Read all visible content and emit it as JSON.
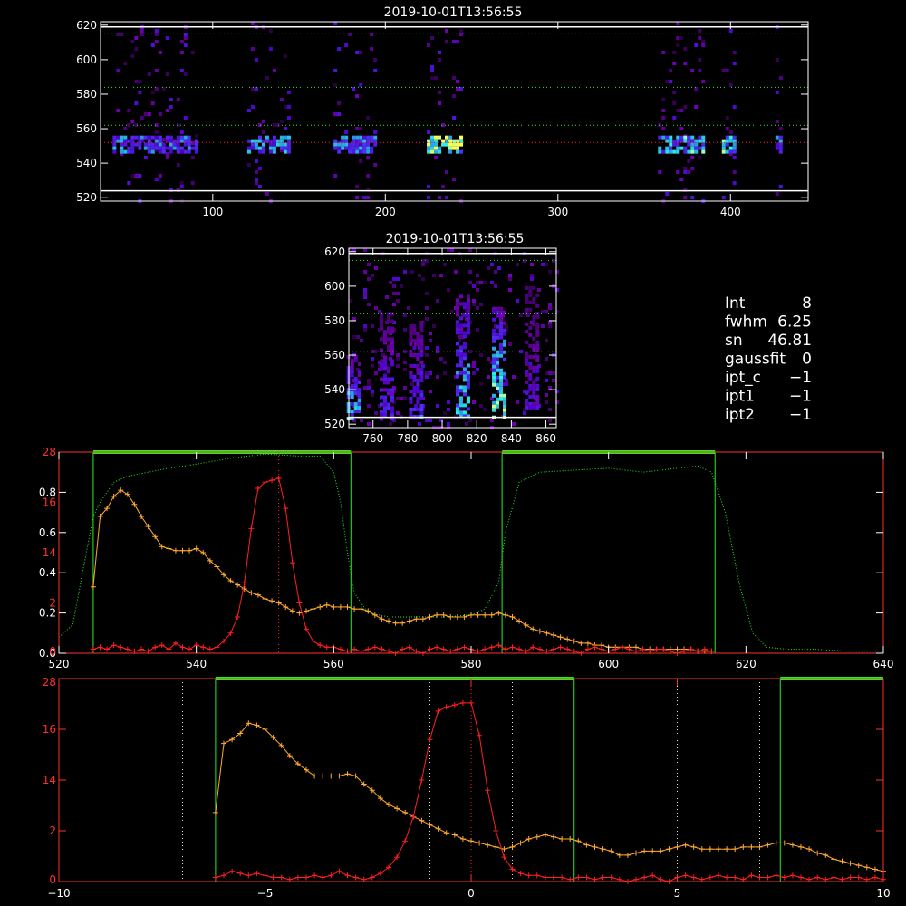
{
  "colors": {
    "background": "#000000",
    "axis": "#ffffff",
    "axis_red": "#ff3030",
    "green": "#22ee22",
    "red": "#ff2020",
    "orange": "#ffaa33",
    "dotted_green": "#22ee22",
    "dotted_white": "#dddddd",
    "dotted_red": "#ff3030"
  },
  "info_panel": {
    "lines": [
      {
        "label": "Int",
        "value": "8"
      },
      {
        "label": "fwhm",
        "value": "6.25"
      },
      {
        "label": "sn",
        "value": "46.81"
      },
      {
        "label": "gaussfit",
        "value": "0"
      },
      {
        "label": "ipt_c",
        "value": "−1"
      },
      {
        "label": "ipt1",
        "value": "−1"
      },
      {
        "label": "ipt2",
        "value": "−1"
      }
    ]
  },
  "chart_data": [
    {
      "id": "top_image",
      "type": "heatmap",
      "title": "2019-10-01T13:56:55",
      "xlim": [
        35,
        445
      ],
      "ylim": [
        518,
        622
      ],
      "xticks": [
        100,
        200,
        300,
        400
      ],
      "yticks": [
        520,
        540,
        560,
        580,
        600,
        620
      ],
      "hlines_white": [
        524,
        619
      ],
      "hlines_green": [
        562,
        584,
        615
      ],
      "hline_red": 552,
      "blocks": [
        {
          "x0": 42,
          "x1": 58,
          "intensity": 0.55
        },
        {
          "x0": 58,
          "x1": 90,
          "intensity": 0.5
        },
        {
          "x0": 120,
          "x1": 145,
          "intensity": 0.6
        },
        {
          "x0": 170,
          "x1": 195,
          "intensity": 0.55
        },
        {
          "x0": 224,
          "x1": 244,
          "intensity": 0.95
        },
        {
          "x0": 358,
          "x1": 385,
          "intensity": 0.7
        },
        {
          "x0": 395,
          "x1": 403,
          "intensity": 0.8
        },
        {
          "x0": 426,
          "x1": 429,
          "intensity": 0.6
        }
      ],
      "band_y": [
        546,
        556
      ]
    },
    {
      "id": "middle_image",
      "type": "heatmap",
      "title": "2019-10-01T13:56:55",
      "xlim": [
        746,
        866
      ],
      "ylim": [
        518,
        622
      ],
      "xticks": [
        760,
        780,
        800,
        820,
        840,
        860
      ],
      "yticks": [
        520,
        540,
        560,
        580,
        600,
        620
      ],
      "hlines_white": [
        524,
        619
      ],
      "hlines_green": [
        562,
        584,
        615
      ],
      "streaks": [
        {
          "x": 749,
          "y0": 524,
          "y1": 560,
          "intensity": 0.7
        },
        {
          "x": 768,
          "y0": 524,
          "y1": 585,
          "intensity": 0.45
        },
        {
          "x": 785,
          "y0": 524,
          "y1": 580,
          "intensity": 0.5
        },
        {
          "x": 812,
          "y0": 524,
          "y1": 595,
          "intensity": 0.75
        },
        {
          "x": 833,
          "y0": 524,
          "y1": 588,
          "intensity": 0.95
        },
        {
          "x": 852,
          "y0": 530,
          "y1": 600,
          "intensity": 0.35
        }
      ]
    },
    {
      "id": "spectrum_wavelength",
      "type": "line",
      "xlim": [
        520,
        640
      ],
      "ylim_left": [
        0.0,
        1.0
      ],
      "yticks_left": [
        0.0,
        0.2,
        0.4,
        0.6,
        0.8
      ],
      "xticks": [
        520,
        540,
        560,
        580,
        600,
        620,
        640
      ],
      "right_axis_labels": [
        {
          "text": "0",
          "y": 0.0
        },
        {
          "text": "2",
          "y": 0.25
        },
        {
          "text": "14",
          "y": 0.5
        },
        {
          "text": "16",
          "y": 0.75
        },
        {
          "text": "28",
          "y": 1.0
        }
      ],
      "green_windows": [
        [
          525,
          562.5
        ],
        [
          584.5,
          615.5
        ]
      ],
      "red_vline": 552,
      "filter_curve": {
        "name": "",
        "x": [
          520,
          522,
          524,
          525,
          526,
          528,
          530,
          533,
          536,
          540,
          545,
          550,
          555,
          558,
          560,
          561,
          562,
          563,
          565,
          568,
          572,
          576,
          580,
          582,
          584,
          585,
          587,
          590,
          595,
          600,
          605,
          610,
          613,
          615,
          617,
          619,
          621,
          623,
          626,
          630,
          635,
          640
        ],
        "y": [
          0.08,
          0.14,
          0.5,
          0.68,
          0.75,
          0.85,
          0.88,
          0.9,
          0.92,
          0.94,
          0.97,
          0.99,
          0.98,
          0.98,
          0.9,
          0.75,
          0.5,
          0.3,
          0.2,
          0.18,
          0.18,
          0.18,
          0.19,
          0.22,
          0.35,
          0.6,
          0.85,
          0.9,
          0.91,
          0.92,
          0.9,
          0.92,
          0.93,
          0.9,
          0.7,
          0.35,
          0.1,
          0.03,
          0.02,
          0.02,
          0.01,
          0.01
        ]
      },
      "red_series": {
        "name": "",
        "x": [
          525,
          526,
          527,
          528,
          529,
          530,
          531,
          532,
          533,
          534,
          535,
          536,
          537,
          538,
          539,
          540,
          541,
          542,
          543,
          544,
          545,
          546,
          547,
          548,
          549,
          550,
          551,
          552,
          553,
          554,
          555,
          556,
          557,
          558,
          559,
          560,
          561,
          562,
          563,
          564,
          565,
          566,
          567,
          568,
          569,
          570,
          571,
          572,
          573,
          574,
          575,
          576,
          577,
          578,
          579,
          580,
          581,
          582,
          583,
          584,
          585,
          586,
          587,
          588,
          589,
          590,
          591,
          592,
          593,
          594,
          595,
          596,
          597,
          598,
          599,
          600,
          601,
          602,
          603,
          604,
          605,
          606,
          607,
          608,
          609,
          610,
          611,
          612,
          613,
          614,
          615
        ],
        "y": [
          0.02,
          0.03,
          0.02,
          0.04,
          0.03,
          0.02,
          0.01,
          0.02,
          0.01,
          0.03,
          0.04,
          0.02,
          0.05,
          0.03,
          0.02,
          0.04,
          0.03,
          0.02,
          0.03,
          0.06,
          0.1,
          0.18,
          0.35,
          0.62,
          0.82,
          0.85,
          0.86,
          0.87,
          0.72,
          0.45,
          0.25,
          0.12,
          0.06,
          0.04,
          0.03,
          0.03,
          0.02,
          0.01,
          0.02,
          0.01,
          0.02,
          0.03,
          0.02,
          0.01,
          0.0,
          0.02,
          0.03,
          0.01,
          0.0,
          0.02,
          0.03,
          0.02,
          0.01,
          0.02,
          0.03,
          0.02,
          0.01,
          0.02,
          0.03,
          0.04,
          0.02,
          0.03,
          0.02,
          0.01,
          0.03,
          0.02,
          0.01,
          0.02,
          0.03,
          0.02,
          0.01,
          0.0,
          0.02,
          0.03,
          0.02,
          0.01,
          0.02,
          0.03,
          0.02,
          0.01,
          0.02,
          0.01,
          0.02,
          0.02,
          0.01,
          0.0,
          0.01,
          0.02,
          0.01,
          0.02,
          0.01
        ]
      },
      "orange_series": {
        "name": "",
        "x": [
          525,
          526,
          527,
          528,
          529,
          530,
          531,
          532,
          533,
          534,
          535,
          536,
          537,
          538,
          539,
          540,
          541,
          542,
          543,
          544,
          545,
          546,
          547,
          548,
          549,
          550,
          551,
          552,
          553,
          554,
          555,
          556,
          557,
          558,
          559,
          560,
          561,
          562,
          563,
          564,
          565,
          566,
          567,
          568,
          569,
          570,
          571,
          572,
          573,
          574,
          575,
          576,
          577,
          578,
          579,
          580,
          581,
          582,
          583,
          584,
          585,
          586,
          587,
          588,
          589,
          590,
          591,
          592,
          593,
          594,
          595,
          596,
          597,
          598,
          599,
          600,
          601,
          602,
          603,
          604,
          605,
          606,
          607,
          608,
          609,
          610,
          611,
          612,
          613,
          614,
          615
        ],
        "y": [
          0.33,
          0.68,
          0.72,
          0.78,
          0.81,
          0.79,
          0.74,
          0.68,
          0.63,
          0.58,
          0.53,
          0.52,
          0.51,
          0.51,
          0.51,
          0.52,
          0.5,
          0.46,
          0.43,
          0.39,
          0.36,
          0.34,
          0.32,
          0.3,
          0.29,
          0.27,
          0.26,
          0.25,
          0.23,
          0.21,
          0.2,
          0.21,
          0.22,
          0.23,
          0.24,
          0.23,
          0.23,
          0.23,
          0.22,
          0.22,
          0.21,
          0.19,
          0.17,
          0.16,
          0.15,
          0.15,
          0.16,
          0.17,
          0.17,
          0.18,
          0.19,
          0.19,
          0.18,
          0.18,
          0.18,
          0.19,
          0.19,
          0.19,
          0.19,
          0.2,
          0.19,
          0.18,
          0.16,
          0.14,
          0.12,
          0.11,
          0.1,
          0.09,
          0.08,
          0.07,
          0.06,
          0.05,
          0.05,
          0.04,
          0.04,
          0.03,
          0.03,
          0.03,
          0.03,
          0.03,
          0.02,
          0.02,
          0.02,
          0.02,
          0.02,
          0.02,
          0.02,
          0.02,
          0.01,
          0.01,
          0.01
        ]
      }
    },
    {
      "id": "spectrum_velocity",
      "type": "line",
      "xlim": [
        -10,
        10
      ],
      "ylim": [
        0,
        1.0
      ],
      "xticks": [
        -10,
        -5,
        0,
        5,
        10
      ],
      "left_axis_labels": [
        {
          "text": "0",
          "y": 0.0
        },
        {
          "text": "2",
          "y": 0.25
        },
        {
          "text": "14",
          "y": 0.5
        },
        {
          "text": "16",
          "y": 0.75
        },
        {
          "text": "28",
          "y": 1.0
        }
      ],
      "green_windows": [
        [
          -6.2,
          2.5
        ],
        [
          7.5,
          10
        ]
      ],
      "white_vlines": [
        -7,
        -5,
        -1,
        1,
        5,
        7
      ],
      "red_vline": 0,
      "red_series": {
        "name": "",
        "x": [
          -6.2,
          -6.0,
          -5.8,
          -5.6,
          -5.4,
          -5.2,
          -5.0,
          -4.8,
          -4.6,
          -4.4,
          -4.2,
          -4.0,
          -3.8,
          -3.6,
          -3.4,
          -3.2,
          -3.0,
          -2.8,
          -2.6,
          -2.4,
          -2.2,
          -2.0,
          -1.8,
          -1.6,
          -1.4,
          -1.2,
          -1.0,
          -0.8,
          -0.6,
          -0.4,
          -0.2,
          0.0,
          0.2,
          0.4,
          0.6,
          0.8,
          1.0,
          1.2,
          1.4,
          1.6,
          1.8,
          2.0,
          2.2,
          2.4,
          2.6,
          2.8,
          3.0,
          3.2,
          3.4,
          3.6,
          3.8,
          4.0,
          4.2,
          4.4,
          4.6,
          4.8,
          5.0,
          5.2,
          5.4,
          5.6,
          5.8,
          6.0,
          6.2,
          6.4,
          6.6,
          6.8,
          7.0,
          7.2,
          7.4,
          7.6,
          7.8,
          8.0,
          8.2,
          8.4,
          8.6,
          8.8,
          9.0,
          9.2,
          9.4,
          9.6,
          9.8,
          10.0
        ],
        "y": [
          0.02,
          0.03,
          0.05,
          0.04,
          0.03,
          0.04,
          0.03,
          0.02,
          0.02,
          0.01,
          0.02,
          0.02,
          0.03,
          0.02,
          0.03,
          0.05,
          0.03,
          0.02,
          0.01,
          0.02,
          0.04,
          0.07,
          0.12,
          0.2,
          0.32,
          0.5,
          0.7,
          0.84,
          0.86,
          0.87,
          0.88,
          0.88,
          0.72,
          0.45,
          0.25,
          0.12,
          0.06,
          0.04,
          0.03,
          0.03,
          0.02,
          0.02,
          0.02,
          0.01,
          0.02,
          0.02,
          0.01,
          0.02,
          0.02,
          0.01,
          0.0,
          0.01,
          0.02,
          0.03,
          0.01,
          0.0,
          0.02,
          0.03,
          0.02,
          0.01,
          0.02,
          0.03,
          0.02,
          0.02,
          0.01,
          0.03,
          0.02,
          0.02,
          0.03,
          0.02,
          0.03,
          0.02,
          0.01,
          0.02,
          0.01,
          0.02,
          0.01,
          0.02,
          0.02,
          0.01,
          0.02,
          0.01
        ]
      },
      "orange_series": {
        "name": "",
        "x": [
          -6.2,
          -6.0,
          -5.8,
          -5.6,
          -5.4,
          -5.2,
          -5.0,
          -4.8,
          -4.6,
          -4.4,
          -4.2,
          -4.0,
          -3.8,
          -3.6,
          -3.4,
          -3.2,
          -3.0,
          -2.8,
          -2.6,
          -2.4,
          -2.2,
          -2.0,
          -1.8,
          -1.6,
          -1.4,
          -1.2,
          -1.0,
          -0.8,
          -0.6,
          -0.4,
          -0.2,
          0.0,
          0.2,
          0.4,
          0.6,
          0.8,
          1.0,
          1.2,
          1.4,
          1.6,
          1.8,
          2.0,
          2.2,
          2.4,
          2.6,
          2.8,
          3.0,
          3.2,
          3.4,
          3.6,
          3.8,
          4.0,
          4.2,
          4.4,
          4.6,
          4.8,
          5.0,
          5.2,
          5.4,
          5.6,
          5.8,
          6.0,
          6.2,
          6.4,
          6.6,
          6.8,
          7.0,
          7.2,
          7.4,
          7.6,
          7.8,
          8.0,
          8.2,
          8.4,
          8.6,
          8.8,
          9.0,
          9.2,
          9.4,
          9.6,
          9.8,
          10.0
        ],
        "y": [
          0.34,
          0.68,
          0.7,
          0.73,
          0.78,
          0.77,
          0.75,
          0.71,
          0.67,
          0.62,
          0.58,
          0.55,
          0.52,
          0.52,
          0.52,
          0.52,
          0.53,
          0.52,
          0.48,
          0.45,
          0.41,
          0.38,
          0.36,
          0.34,
          0.32,
          0.3,
          0.28,
          0.26,
          0.24,
          0.23,
          0.21,
          0.2,
          0.19,
          0.18,
          0.17,
          0.16,
          0.17,
          0.19,
          0.21,
          0.22,
          0.23,
          0.22,
          0.21,
          0.21,
          0.2,
          0.18,
          0.17,
          0.16,
          0.15,
          0.13,
          0.13,
          0.14,
          0.15,
          0.15,
          0.15,
          0.16,
          0.17,
          0.18,
          0.17,
          0.16,
          0.16,
          0.16,
          0.16,
          0.16,
          0.17,
          0.17,
          0.17,
          0.18,
          0.19,
          0.19,
          0.18,
          0.17,
          0.16,
          0.14,
          0.13,
          0.11,
          0.1,
          0.09,
          0.08,
          0.07,
          0.06,
          0.05
        ]
      }
    }
  ]
}
